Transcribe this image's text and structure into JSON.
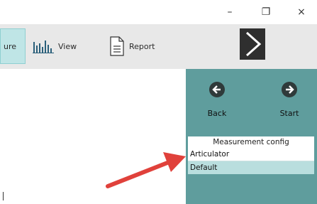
{
  "window": {
    "minimize_glyph": "–",
    "restore_glyph": "❐",
    "close_glyph": "×"
  },
  "toolbar": {
    "active_partial_label": "ure",
    "view_label": "View",
    "report_label": "Report"
  },
  "nav": {
    "back_label": "Back",
    "start_label": "Start"
  },
  "measurement": {
    "header": "Measurement config",
    "items": [
      "Articulator",
      "Default"
    ],
    "selected_index": 1
  },
  "colors": {
    "panel": "#5f9d9d",
    "selection": "#b9dede",
    "active_tab": "#bfe5e6",
    "arrow": "#e0413b"
  }
}
